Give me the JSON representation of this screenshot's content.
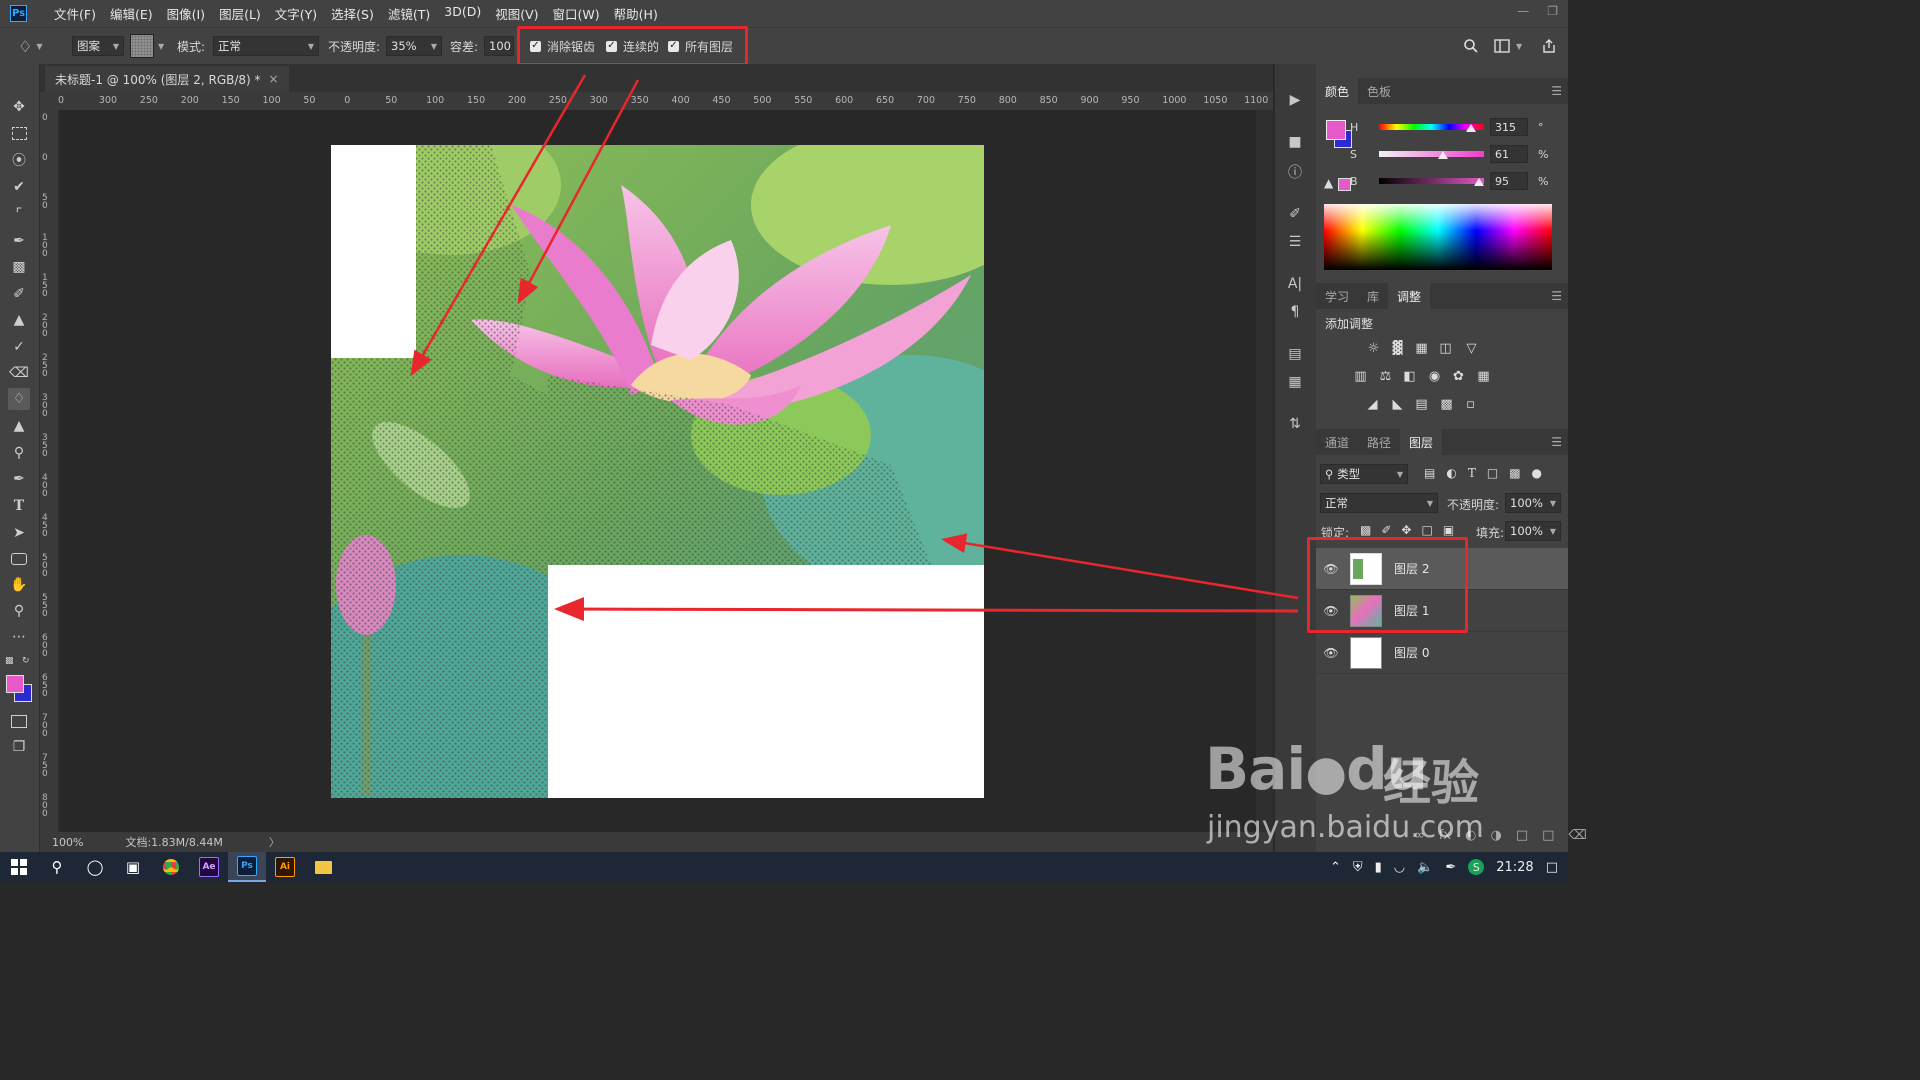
{
  "app": {
    "logo": "Ps"
  },
  "menubar": {
    "items": [
      "文件(F)",
      "编辑(E)",
      "图像(I)",
      "图层(L)",
      "文字(Y)",
      "选择(S)",
      "滤镜(T)",
      "3D(D)",
      "视图(V)",
      "窗口(W)",
      "帮助(H)"
    ]
  },
  "options": {
    "fill_source": "图案",
    "mode_label": "模式:",
    "mode_value": "正常",
    "opacity_label": "不透明度:",
    "opacity_value": "35%",
    "tolerance_label": "容差:",
    "tolerance_value": "100",
    "antialias_label": "消除锯齿",
    "contiguous_label": "连续的",
    "all_layers_label": "所有图层",
    "antialias_checked": true,
    "contiguous_checked": true,
    "all_layers_checked": true
  },
  "document": {
    "tab_title": "未标题-1 @ 100% (图层 2, RGB/8) *",
    "close_glyph": "×",
    "zoom": "100%",
    "doc_info": "文档:1.83M/8.44M",
    "status_arrow": "〉"
  },
  "ruler": {
    "h_labels": [
      "0",
      "300",
      "250",
      "200",
      "150",
      "100",
      "50",
      "0",
      "50",
      "100",
      "150",
      "200",
      "250",
      "300",
      "350",
      "400",
      "450",
      "500",
      "550",
      "600",
      "650",
      "700",
      "750",
      "800",
      "850",
      "900",
      "950",
      "1000",
      "1050",
      "1100"
    ],
    "v_labels": [
      "0",
      "0",
      "5 0",
      "1 0 0",
      "1 5 0",
      "2 0 0",
      "2 5 0",
      "3 0 0",
      "3 5 0",
      "4 0 0",
      "4 5 0",
      "5 0 0",
      "5 5 0",
      "6 0 0",
      "6 5 0",
      "7 0 0",
      "7 5 0",
      "8 0 0"
    ]
  },
  "color_panel": {
    "tabs": [
      "颜色",
      "色板"
    ],
    "active_tab": "颜色",
    "foreground": "#e559c8",
    "background": "#2b2bd0",
    "h_label": "H",
    "h_value": "315",
    "h_unit": "°",
    "s_label": "S",
    "s_value": "61",
    "s_unit": "%",
    "b_label": "B",
    "b_value": "95",
    "b_unit": "%",
    "h_fraction": 0.875,
    "s_fraction": 0.61,
    "b_fraction": 0.95
  },
  "adjust_panel": {
    "tabs": [
      "学习",
      "库",
      "调整"
    ],
    "active_tab": "调整",
    "heading": "添加调整",
    "icons": [
      "brightness-icon",
      "levels-icon",
      "curves-icon",
      "exposure-icon",
      "vibrance-icon",
      "hue-sat-icon",
      "color-balance-icon",
      "black-white-icon",
      "photo-filter-icon",
      "channel-mixer-icon",
      "color-lookup-icon",
      "invert-icon",
      "posterize-icon",
      "threshold-icon",
      "selective-color-icon",
      "gradient-map-icon"
    ]
  },
  "layers_panel": {
    "tabs": [
      "通道",
      "路径",
      "图层"
    ],
    "active_tab": "图层",
    "filter_label": "类型",
    "blend_mode": "正常",
    "opacity_label": "不透明度:",
    "opacity_value": "100%",
    "lock_label": "锁定:",
    "fill_label": "填充:",
    "fill_value": "100%",
    "layers": [
      {
        "name": "图层 2",
        "selected": true
      },
      {
        "name": "图层 1",
        "selected": false
      },
      {
        "name": "图层 0",
        "selected": false
      }
    ]
  },
  "taskbar": {
    "apps": [
      "Ae",
      "Ps",
      "Ai"
    ],
    "time": "21:28"
  },
  "watermark": {
    "brand": "Bai",
    "brand2": "du",
    "cn": "经验",
    "url": "jingyan.baidu.com"
  },
  "colors": {
    "annotation_red": "#e8262d",
    "ps_blue": "#31a8ff"
  }
}
